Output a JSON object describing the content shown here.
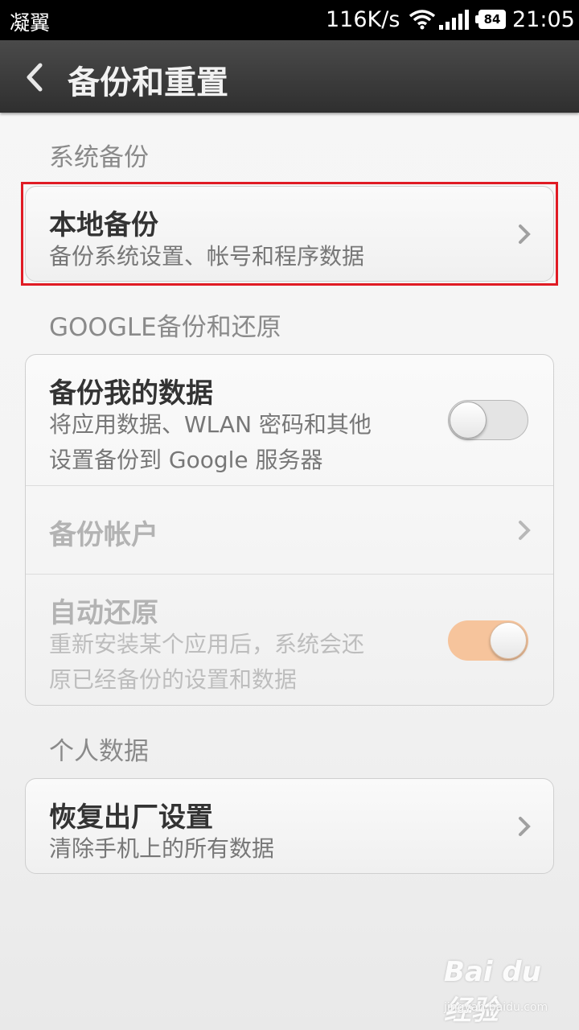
{
  "status_bar": {
    "carrier": "凝翼",
    "net_speed": "116K/s",
    "battery": "84",
    "time": "21:05"
  },
  "header": {
    "title": "备份和重置"
  },
  "sections": {
    "system_backup": {
      "label": "系统备份",
      "local_backup": {
        "title": "本地备份",
        "subtitle": "备份系统设置、帐号和程序数据"
      }
    },
    "google_backup": {
      "label": "GOOGLE备份和还原",
      "backup_my_data": {
        "title": "备份我的数据",
        "subtitle_line1": "将应用数据、WLAN 密码和其他",
        "subtitle_line2": "设置备份到 Google 服务器",
        "enabled": false
      },
      "backup_account": {
        "title": "备份帐户"
      },
      "auto_restore": {
        "title": "自动还原",
        "subtitle_line1": "重新安装某个应用后，系统会还",
        "subtitle_line2": "原已经备份的设置和数据",
        "enabled": true
      }
    },
    "personal_data": {
      "label": "个人数据",
      "factory_reset": {
        "title": "恢复出厂设置",
        "subtitle": "清除手机上的所有数据"
      }
    }
  },
  "watermark": {
    "brand": "Bai du 经验",
    "url": "jingyan.baidu.com"
  },
  "colors": {
    "highlight": "#e01b24",
    "toggle_on": "#f6c49c",
    "header_bg": "#3b3b3b"
  }
}
